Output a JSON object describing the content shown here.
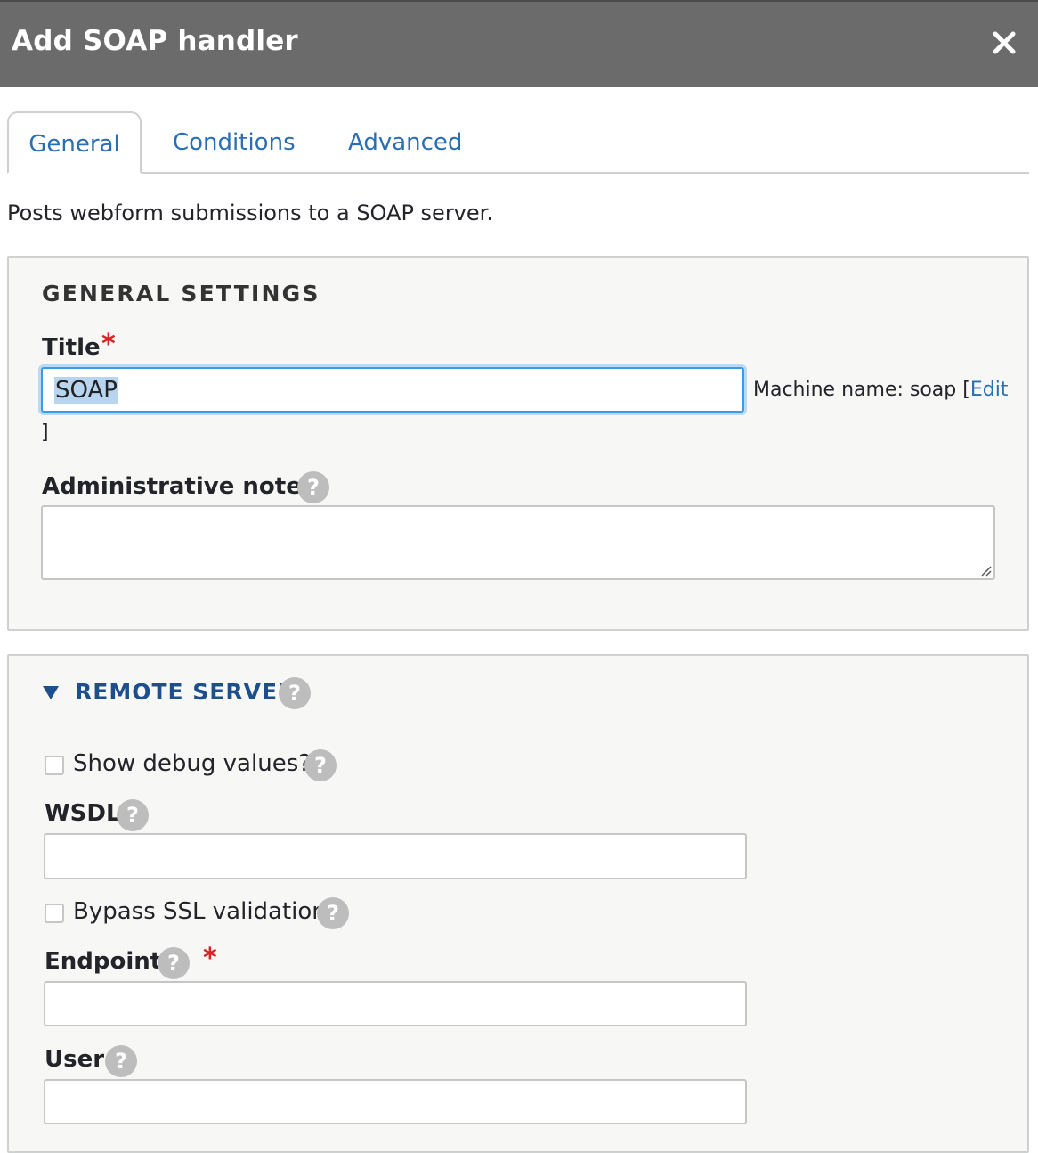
{
  "dialog": {
    "title": "Add SOAP handler",
    "close_icon": "close-icon"
  },
  "tabs": [
    {
      "label": "General",
      "active": true
    },
    {
      "label": "Conditions",
      "active": false
    },
    {
      "label": "Advanced",
      "active": false
    }
  ],
  "description": "Posts webform submissions to a SOAP server.",
  "general_settings": {
    "legend": "GENERAL SETTINGS",
    "title_label": "Title",
    "required_marker": "*",
    "title_value": "SOAP",
    "machine_name_prefix": "Machine name: soap [",
    "machine_name_edit": "Edit",
    "machine_name_suffix": "]",
    "admin_notes_label": "Administrative notes",
    "admin_notes_value": ""
  },
  "remote_server": {
    "summary": "REMOTE SERVER",
    "debug_label": "Show debug values?",
    "debug_checked": false,
    "wsdl_label": "WSDL",
    "wsdl_value": "",
    "ssl_label": "Bypass SSL validation",
    "ssl_checked": false,
    "endpoint_label": "Endpoint",
    "endpoint_required": "*",
    "endpoint_value": "",
    "user_label": "User",
    "user_value": ""
  },
  "help_glyph": "?",
  "colors": {
    "titlebar": "#6b6b6b",
    "link": "#2b6fb3",
    "required": "#d72222",
    "focus": "#3f9ae6",
    "summary": "#1d4f8c"
  }
}
